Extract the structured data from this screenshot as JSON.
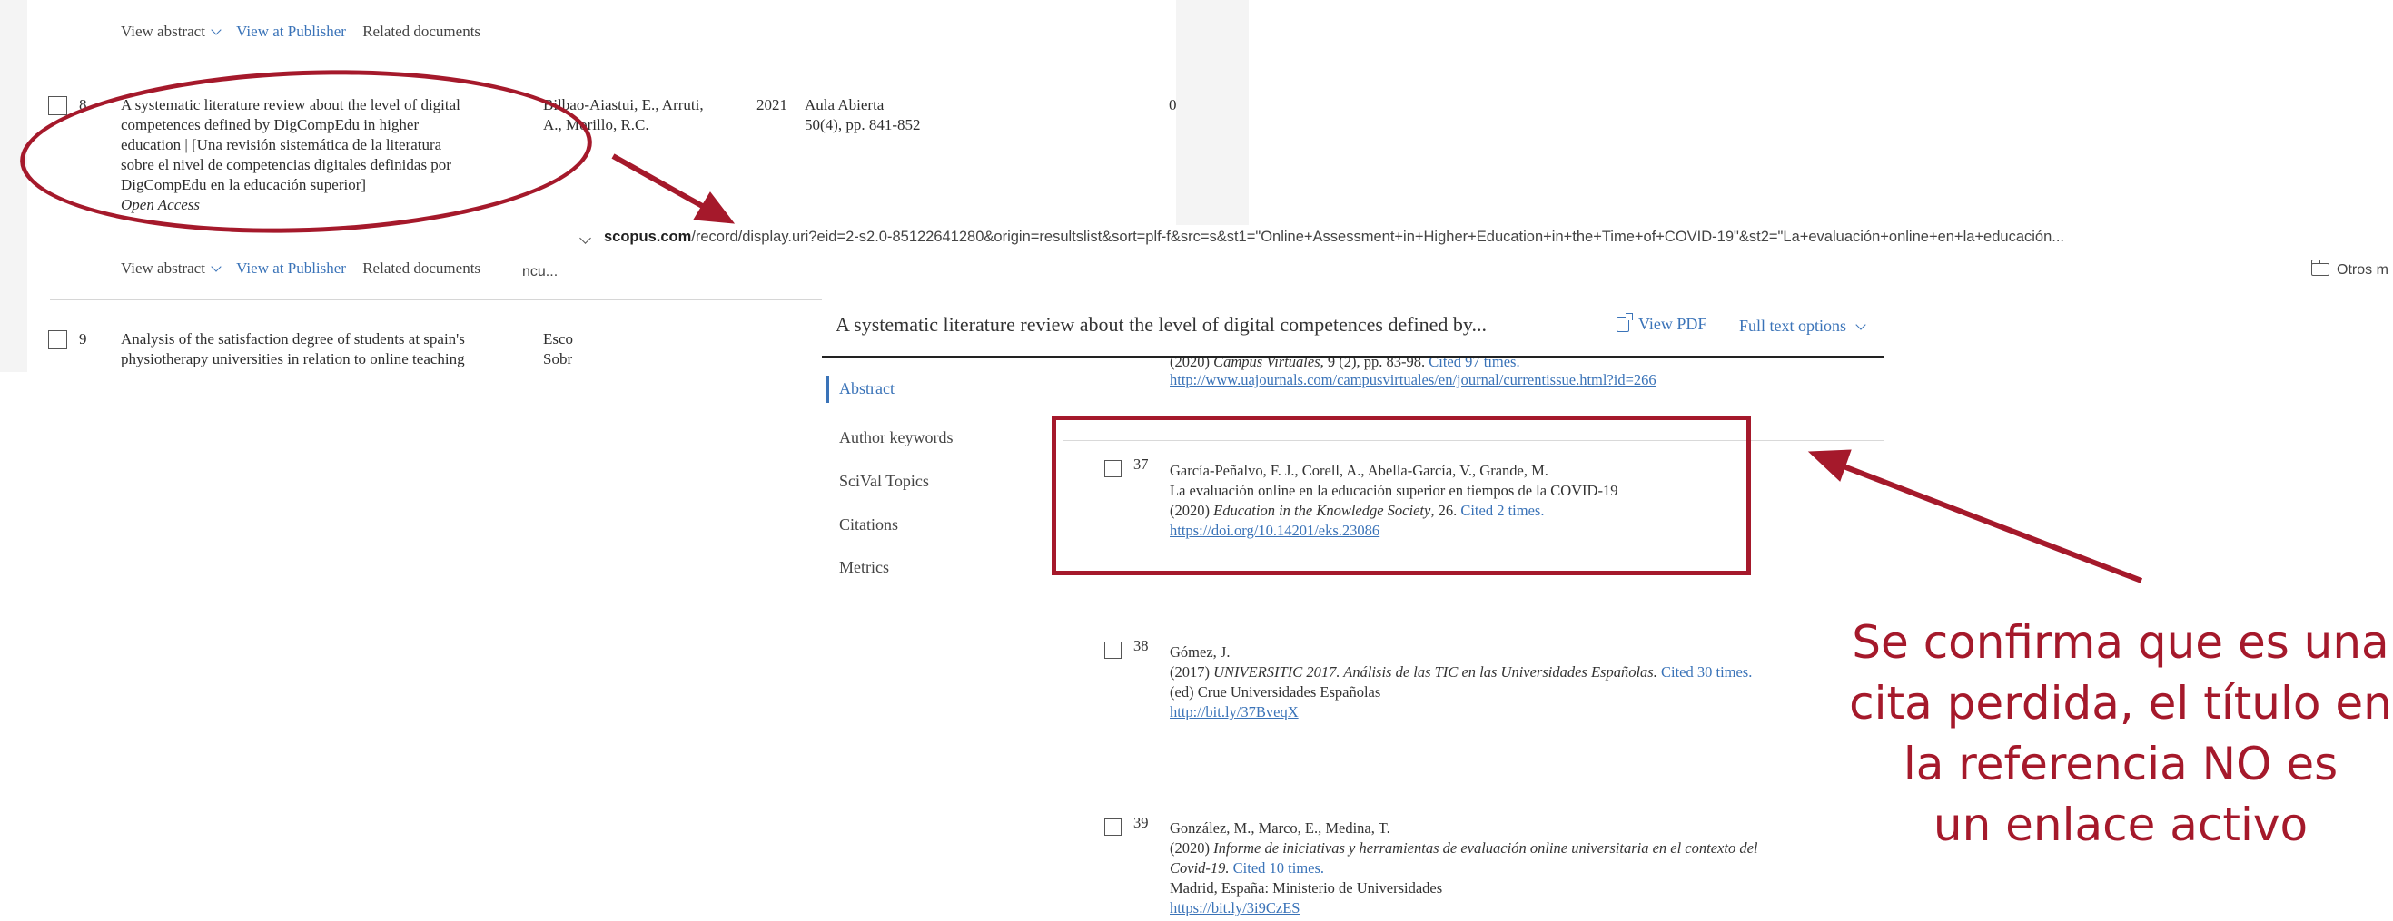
{
  "results": {
    "row7_actions": {
      "view_abstract": "View abstract",
      "view_publisher": "View at Publisher",
      "related": "Related documents"
    },
    "row8": {
      "number": "8",
      "title_lines": [
        "A systematic literature review about the level of digital",
        "competences defined by DigCompEdu in higher",
        "education | [Una revisión sistemática de la literatura",
        "sobre el nivel de competencias digitales definidas por",
        "DigCompEdu en la educación superior]"
      ],
      "open_access": "Open Access",
      "authors_lines": [
        "Bilbao-Aiastui, E., Arruti,",
        "A., Morillo, R.C."
      ],
      "year": "2021",
      "source_lines": [
        "Aula Abierta",
        "50(4), pp. 841-852"
      ],
      "cited": "0",
      "view_abstract": "View abstract",
      "view_publisher": "View at Publisher",
      "related": "Related documents"
    },
    "row9": {
      "number": "9",
      "title_lines": [
        "Analysis of the satisfaction degree of students at spain's",
        "physiotherapy universities in relation to online teaching"
      ],
      "authors_lines": [
        "Esco",
        "Sobr"
      ]
    }
  },
  "browser": {
    "url_domain": "scopus.com",
    "url_path": "/record/display.uri?eid=2-s2.0-85122641280&origin=resultslist&sort=plf-f&src=s&st1=\"Online+Assessment+in+Higher+Education+in+the+Time+of+COVID-19\"&st2=\"La+evaluación+online+en+la+educación...",
    "bookmark_left": "ncu...",
    "bookmark_right": "Otros m"
  },
  "document": {
    "title": "A systematic literature review about the level of digital competences defined by...",
    "view_pdf": "View PDF",
    "full_text_options": "Full text options",
    "sidebar": [
      "Abstract",
      "Author keywords",
      "SciVal Topics",
      "Citations",
      "Metrics"
    ],
    "ref_prev": {
      "year": "(2020)",
      "journal": "Campus Virtuales",
      "detail": ", 9 (2), pp. 83-98.",
      "cited": "Cited 97 times.",
      "url": "http://www.uajournals.com/campusvirtuales/en/journal/currentissue.html?id=266"
    },
    "ref37": {
      "number": "37",
      "authors": "García-Peñalvo, F. J., Corell, A., Abella-García, V., Grande, M.",
      "title": "La evaluación online en la educación superior en tiempos de la COVID-19",
      "year": "(2020)",
      "journal": "Education in the Knowledge Society",
      "detail": ", 26.",
      "cited": "Cited 2 times.",
      "url": "https://doi.org/10.14201/eks.23086"
    },
    "ref38": {
      "number": "38",
      "authors": "Gómez, J.",
      "year": "(2017)",
      "title": "UNIVERSITIC 2017. Análisis de las TIC en las Universidades Españolas.",
      "cited": "Cited 30 times.",
      "editor": "(ed) Crue Universidades Españolas",
      "url": "http://bit.ly/37BveqX"
    },
    "ref39": {
      "number": "39",
      "authors": "González, M., Marco, E., Medina, T.",
      "year": "(2020)",
      "title_line1": "Informe de iniciativas y herramientas de evaluación online universitaria en el contexto del",
      "title_line2": "Covid-19.",
      "cited": "Cited 10 times.",
      "publisher": "Madrid, España: Ministerio de Universidades",
      "url": "https://bit.ly/3i9CzES"
    }
  },
  "annotation": {
    "color": "#a5192b",
    "lines": [
      "Se confirma que es una",
      "cita perdida, el título en",
      "la referencia NO es",
      "un enlace activo"
    ]
  }
}
